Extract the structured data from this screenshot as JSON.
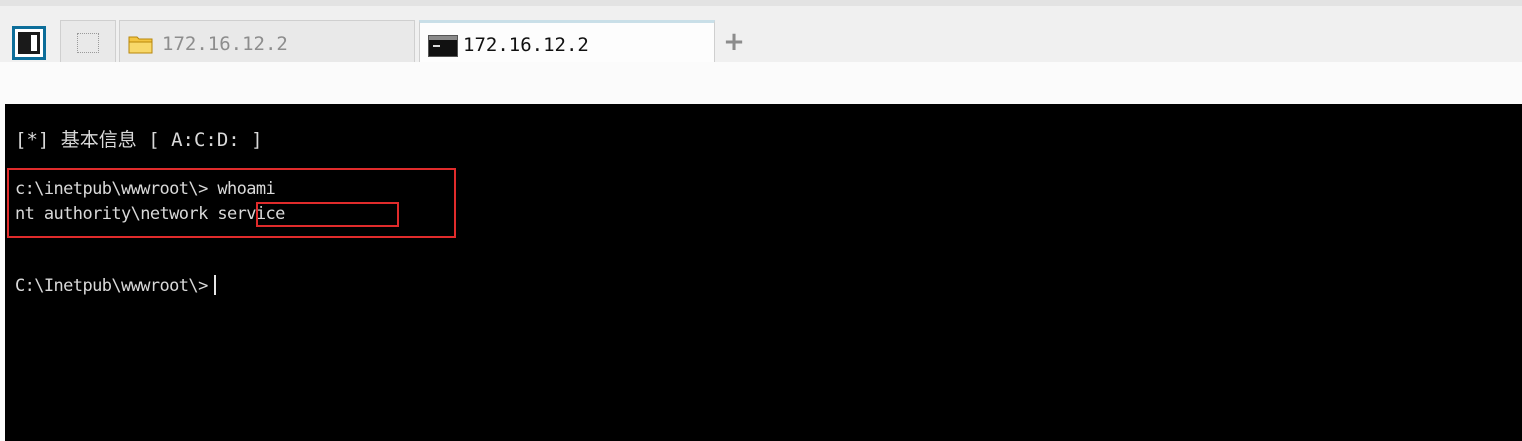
{
  "tabs": [
    {
      "label": "",
      "kind": "blank",
      "active": false
    },
    {
      "label": "172.16.12.2",
      "kind": "file-manager",
      "icon": "folder-icon",
      "active": false
    },
    {
      "label": "172.16.12.2",
      "kind": "terminal",
      "icon": "terminal-icon",
      "active": true
    }
  ],
  "add_tab_label": "+",
  "terminal": {
    "info_line": "[*] 基本信息 [ A:C:D: ]",
    "command_line": "c:\\inetpub\\wwwroot\\> whoami",
    "output_line": "nt authority\\network service",
    "prompt_line": "C:\\Inetpub\\wwwroot\\>"
  },
  "colors": {
    "terminal_bg": "#000000",
    "terminal_fg": "#d9d9d9",
    "highlight": "#e02b2b",
    "toggle_border": "#0d6e9a"
  }
}
